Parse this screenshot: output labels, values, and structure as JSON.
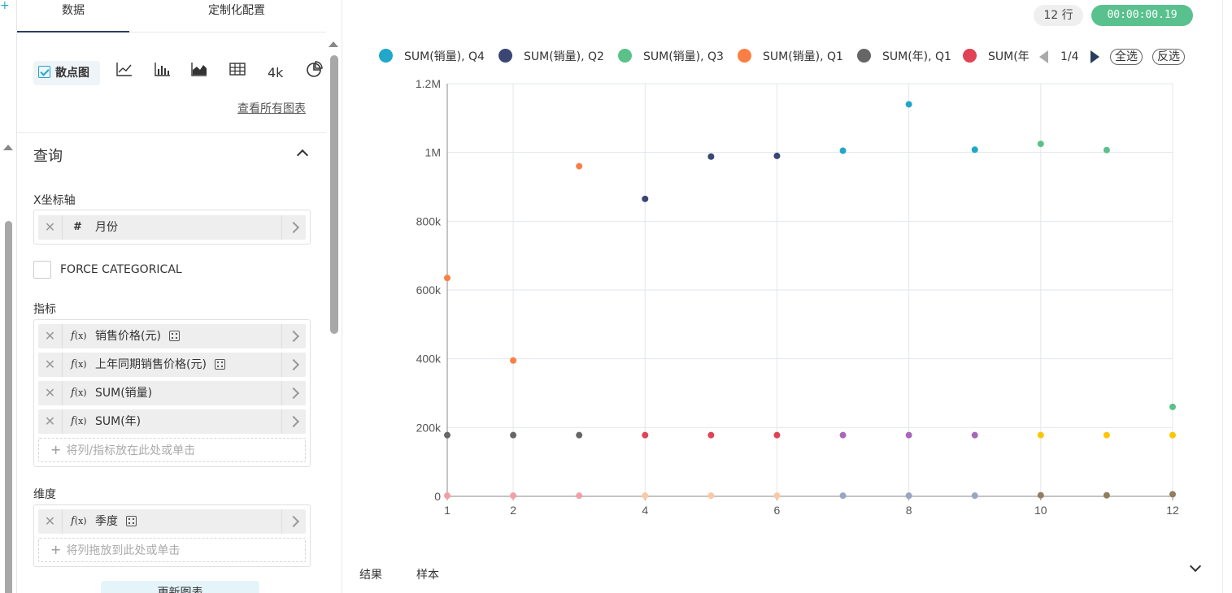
{
  "left_tabs": [
    "数据",
    "定制化配置"
  ],
  "chart_types": {
    "scatter": "散点图",
    "big_number": "4k",
    "see_all": "查看所有图表"
  },
  "query": {
    "title": "查询",
    "x_axis_label": "X坐标轴",
    "x_axis_field": "月份",
    "force_categorical": "FORCE CATEGORICAL",
    "metrics_label": "指标",
    "metrics": [
      "销售价格(元)",
      "上年同期销售价格(元)",
      "SUM(销量)",
      "SUM(年)"
    ],
    "metrics_drop_hint": "将列/指标放在此处或单击",
    "dimensions_label": "维度",
    "dimensions": [
      "季度"
    ],
    "dimensions_drop_hint": "将列拖放到此处或单击",
    "run_button": "更新图表"
  },
  "status": {
    "rows": "12 行",
    "timer": "00:00:00.19"
  },
  "legend": {
    "items": [
      {
        "name": "SUM(销量), Q4",
        "color": "#20a7c9"
      },
      {
        "name": "SUM(销量), Q2",
        "color": "#3b4675"
      },
      {
        "name": "SUM(销量), Q3",
        "color": "#5ac189"
      },
      {
        "name": "SUM(销量), Q1",
        "color": "#fb7f44"
      },
      {
        "name": "SUM(年), Q1",
        "color": "#666666"
      },
      {
        "name": "SUM(年",
        "color": "#e04355"
      }
    ],
    "page": "1/4",
    "select_all": "全选",
    "invert": "反选"
  },
  "bottom_tabs": [
    "结果",
    "样本"
  ],
  "chart_data": {
    "type": "scatter",
    "x_ticks": [
      "1",
      "2",
      "4",
      "6",
      "8",
      "10",
      "12"
    ],
    "y_ticks": [
      "0",
      "200k",
      "400k",
      "600k",
      "800k",
      "1M",
      "1.2M"
    ],
    "xlim": [
      1,
      12
    ],
    "ylim": [
      0,
      1200000
    ],
    "grid": true,
    "points": [
      {
        "x": 1,
        "y": 635000,
        "color": "#fb7f44"
      },
      {
        "x": 2,
        "y": 395000,
        "color": "#fb7f44"
      },
      {
        "x": 3,
        "y": 960000,
        "color": "#fb7f44"
      },
      {
        "x": 4,
        "y": 865000,
        "color": "#3b4675"
      },
      {
        "x": 5,
        "y": 988000,
        "color": "#3b4675"
      },
      {
        "x": 6,
        "y": 990000,
        "color": "#3b4675"
      },
      {
        "x": 7,
        "y": 1005000,
        "color": "#20a7c9"
      },
      {
        "x": 8,
        "y": 1140000,
        "color": "#20a7c9"
      },
      {
        "x": 9,
        "y": 1008000,
        "color": "#20a7c9"
      },
      {
        "x": 10,
        "y": 1025000,
        "color": "#5ac189"
      },
      {
        "x": 11,
        "y": 1007000,
        "color": "#5ac189"
      },
      {
        "x": 12,
        "y": 260000,
        "color": "#5ac189"
      },
      {
        "x": 1,
        "y": 178000,
        "color": "#666666"
      },
      {
        "x": 2,
        "y": 178000,
        "color": "#666666"
      },
      {
        "x": 3,
        "y": 178000,
        "color": "#666666"
      },
      {
        "x": 4,
        "y": 178000,
        "color": "#e04355"
      },
      {
        "x": 5,
        "y": 178000,
        "color": "#e04355"
      },
      {
        "x": 6,
        "y": 178000,
        "color": "#e04355"
      },
      {
        "x": 7,
        "y": 178000,
        "color": "#a868b7"
      },
      {
        "x": 8,
        "y": 178000,
        "color": "#a868b7"
      },
      {
        "x": 9,
        "y": 178000,
        "color": "#a868b7"
      },
      {
        "x": 10,
        "y": 178000,
        "color": "#fdc602"
      },
      {
        "x": 11,
        "y": 178000,
        "color": "#fdc602"
      },
      {
        "x": 12,
        "y": 178000,
        "color": "#fdc602"
      },
      {
        "x": 1,
        "y": 2000,
        "color": "#f2a0a8"
      },
      {
        "x": 2,
        "y": 2000,
        "color": "#f2a0a8"
      },
      {
        "x": 3,
        "y": 2000,
        "color": "#f2a0a8"
      },
      {
        "x": 4,
        "y": 2000,
        "color": "#fcc8a6"
      },
      {
        "x": 5,
        "y": 2000,
        "color": "#fcc8a6"
      },
      {
        "x": 6,
        "y": 2000,
        "color": "#fcc8a6"
      },
      {
        "x": 7,
        "y": 2000,
        "color": "#9aa5c0"
      },
      {
        "x": 8,
        "y": 2000,
        "color": "#9aa5c0"
      },
      {
        "x": 9,
        "y": 2000,
        "color": "#9aa5c0"
      },
      {
        "x": 10,
        "y": 3000,
        "color": "#8f7e60"
      },
      {
        "x": 11,
        "y": 3000,
        "color": "#8f7e60"
      },
      {
        "x": 12,
        "y": 6000,
        "color": "#8f7e60"
      }
    ]
  }
}
